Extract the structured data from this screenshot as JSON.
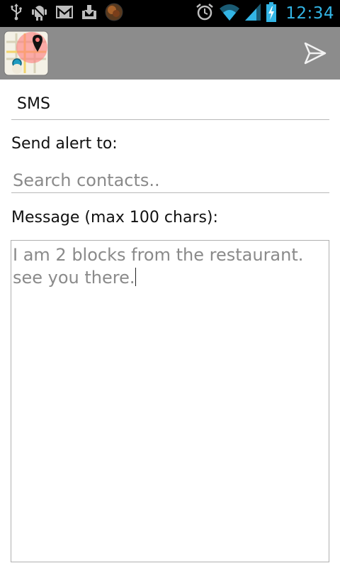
{
  "status_bar": {
    "time": "12:34",
    "left_icons": [
      "usb-icon",
      "android-debug-icon",
      "gmail-icon",
      "download-icon",
      "app-sphere-icon"
    ],
    "right_icons": [
      "alarm-icon",
      "wifi-icon",
      "signal-icon",
      "battery-charging-icon"
    ],
    "accent_color": "#33b5e5"
  },
  "action_bar": {
    "app_icon": "map-pin-app-icon",
    "send_icon": "send-icon",
    "background": "#8c8c8c"
  },
  "form": {
    "channel": "SMS",
    "send_alert_label": "Send alert to:",
    "search_placeholder": "Search contacts..",
    "message_label": "Message (max 100 chars):",
    "message_text": "I am 2 blocks from the restaurant.\nsee you there."
  }
}
